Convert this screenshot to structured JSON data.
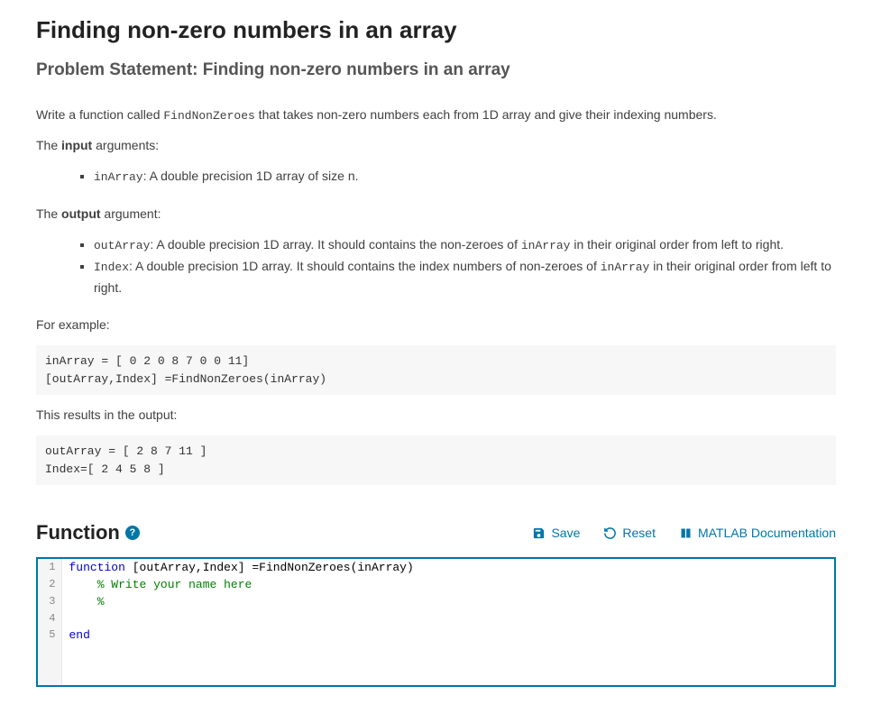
{
  "title": "Finding non-zero numbers in an array",
  "subtitle": "Problem Statement: Finding non-zero numbers in an array",
  "intro_pre": "Write a function called ",
  "intro_fn": "FindNonZeroes",
  "intro_post": " that takes non-zero numbers each from 1D array and give their indexing numbers.",
  "input_label_pre": "The ",
  "input_label_bold": "input",
  "input_label_post": " arguments:",
  "input_item_name": "inArray",
  "input_item_desc": ": A double precision 1D array of size n.",
  "output_label_pre": "The ",
  "output_label_bold": "output",
  "output_label_post": " argument:",
  "out1_name": "outArray",
  "out1_desc_a": ": A double precision 1D array. It should contains the non-zeroes of ",
  "out1_desc_b": " in their original order from left to right.",
  "out2_name": "Index",
  "out2_desc_a": ": A double precision 1D array. It should contains the index numbers of non-zeroes of ",
  "out2_desc_b": " in their original order from left to right.",
  "inArray_ref": "inArray",
  "example_label": "For example:",
  "example_code": "inArray = [ 0 2 0 8 7 0 0 11]\n[outArray,Index] =FindNonZeroes(inArray)",
  "result_label": "This results in the output:",
  "result_code": "outArray = [ 2 8 7 11 ]\nIndex=[ 2 4 5 8 ]",
  "func_heading": "Function",
  "help_glyph": "?",
  "actions": {
    "save": "Save",
    "reset": "Reset",
    "docs": "MATLAB Documentation"
  },
  "editor": {
    "ln1": "1",
    "ln2": "2",
    "ln3": "3",
    "ln4": "4",
    "ln5": "5",
    "l1_kw": "function",
    "l1_rest": " [outArray,Index] =FindNonZeroes(inArray)",
    "l2": "    % Write your name here",
    "l3": "    %",
    "l4": "",
    "l5_kw": "end"
  }
}
